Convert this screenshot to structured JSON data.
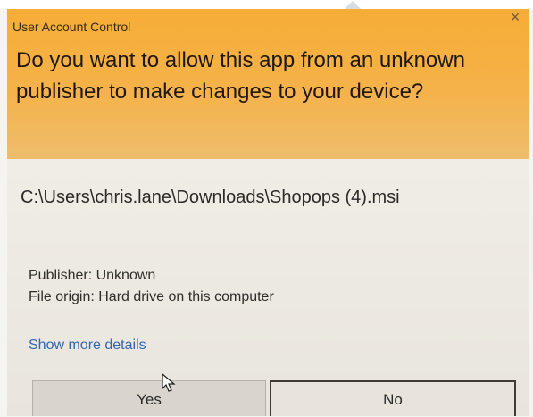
{
  "window": {
    "title": "User Account Control"
  },
  "dialog": {
    "question": "Do you want to allow this app from an unknown publisher to make changes to your device?",
    "path": "C:\\Users\\chris.lane\\Downloads\\Shopops (4).msi",
    "publisher": "Publisher: Unknown",
    "origin": "File origin: Hard drive on this computer",
    "details_link": "Show more details"
  },
  "buttons": {
    "yes": "Yes",
    "no": "No"
  },
  "icons": {
    "close": "close-icon",
    "cursor": "mouse-pointer-icon"
  },
  "colors": {
    "header": "#f6ad36",
    "body": "#e9e5de",
    "link": "#2f67b4"
  }
}
